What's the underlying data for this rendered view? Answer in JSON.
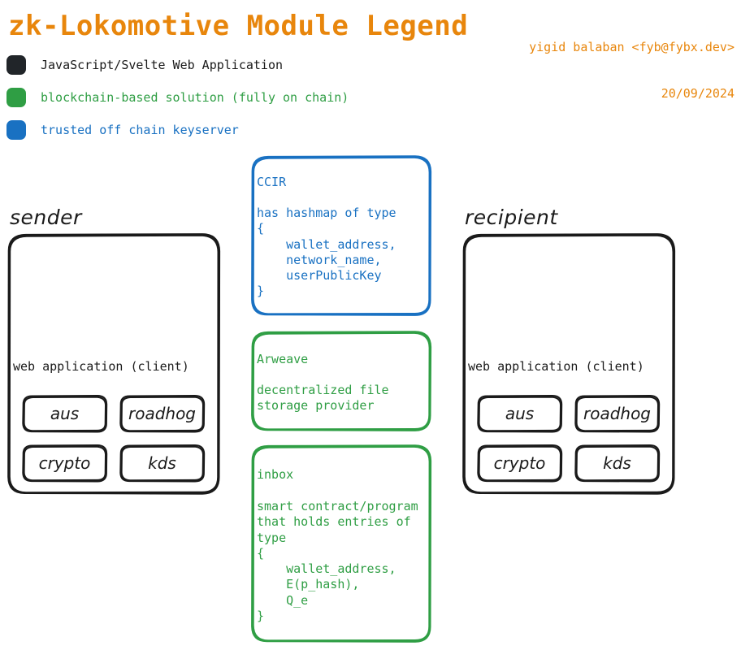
{
  "header": {
    "title": "zk-Lokomotive Module Legend",
    "author": "yigid balaban <fyb@fybx.dev>",
    "date": "20/09/2024",
    "accent_color": "#e8860c"
  },
  "legend": {
    "items": [
      {
        "swatch_color": "#212529",
        "label": "JavaScript/Svelte Web Application",
        "text_color": "#1a1a1a"
      },
      {
        "swatch_color": "#2f9e44",
        "label": "blockchain-based solution (fully on chain)",
        "text_color": "#2f9e44"
      },
      {
        "swatch_color": "#1971c2",
        "label": "trusted off chain keyserver",
        "text_color": "#1971c2"
      }
    ]
  },
  "diagram": {
    "sender": {
      "group_label": "sender",
      "client_label": "web application (client)",
      "modules": [
        {
          "label": "aus"
        },
        {
          "label": "roadhog"
        },
        {
          "label": "crypto"
        },
        {
          "label": "kds"
        }
      ]
    },
    "recipient": {
      "group_label": "recipient",
      "client_label": "web application (client)",
      "modules": [
        {
          "label": "aus"
        },
        {
          "label": "roadhog"
        },
        {
          "label": "crypto"
        },
        {
          "label": "kds"
        }
      ]
    },
    "center_boxes": [
      {
        "name": "ccir",
        "color": "#1971c2",
        "title": "CCIR",
        "body": "has hashmap of type\n{\n    wallet_address,\n    network_name,\n    userPublicKey\n}"
      },
      {
        "name": "arweave",
        "color": "#2f9e44",
        "title": "Arweave",
        "body": "decentralized file\nstorage provider"
      },
      {
        "name": "inbox",
        "color": "#2f9e44",
        "title": "inbox",
        "body": "smart contract/program\nthat holds entries of\ntype\n{\n    wallet_address,\n    E(p_hash),\n    Q_e\n}"
      }
    ]
  }
}
